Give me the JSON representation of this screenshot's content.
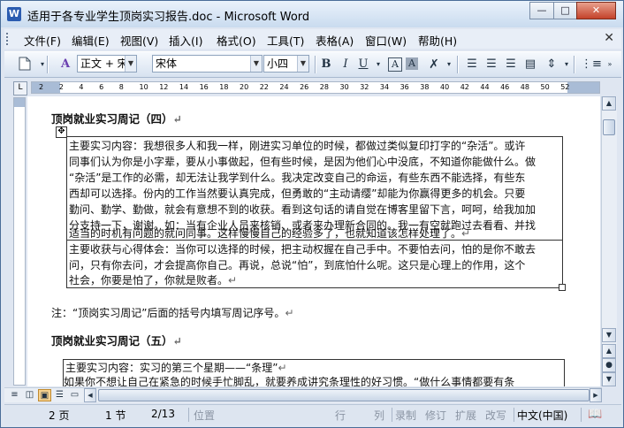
{
  "window": {
    "title": "适用于各专业学生顶岗实习报告.doc - Microsoft Word",
    "app_icon": "W",
    "controls": {
      "minimize": "—",
      "maximize": "□",
      "close": "✕"
    }
  },
  "menu": {
    "items": [
      "文件(F)",
      "编辑(E)",
      "视图(V)",
      "插入(I)",
      "格式(O)",
      "工具(T)",
      "表格(A)",
      "窗口(W)",
      "帮助(H)"
    ],
    "close_doc": "✕"
  },
  "toolbar": {
    "style_value": "正文 + 宋体",
    "font_value": "宋体",
    "size_value": "小四",
    "bold": "B",
    "italic": "I",
    "underline": "U"
  },
  "ruler": {
    "tab_selector": "L",
    "numbers": [
      "2",
      "2",
      "4",
      "6",
      "8",
      "10",
      "12",
      "14",
      "16",
      "18",
      "20",
      "22",
      "24",
      "26",
      "28",
      "30",
      "32",
      "34",
      "36",
      "38",
      "40",
      "42",
      "44",
      "46",
      "48",
      "50",
      "52"
    ]
  },
  "document": {
    "heading4": "顶岗就业实习周记（四）",
    "table1": {
      "row1_lines": [
        "主要实习内容：我想很多人和我一样，刚进实习单位的时候，都做过类似复印打字的“杂活”。或许",
        "同事们认为你是小字辈，要从小事做起，但有些时候，是因为他们心中没底，不知道你能做什么。做",
        "“杂活”是工作的必需，却无法让我学到什么。我决定改变自己的命运，有些东西不能选择，有些东",
        "西却可以选择。份内的工作当然要认真完成，但勇敢的“主动请缨”却能为你赢得更多的机会。只要",
        "勤问、勤学、勤做，就会有意想不到的收获。看到这句话的请自觉在博客里留下言，呵呵，给我加加",
        "分支持一下，谢谢。如：当有企业人员来核销、或者来办理新合同的。我一有空就跑过去看看、并找",
        "适当的时机有问题的就问同事。这样慢慢自己的经验多了，也就知道该怎样处理了。"
      ],
      "row2_lines": [
        "主要收获与心得体会：当你可以选择的时候，把主动权握在自己手中。不要怕去问，怕的是你不敢去",
        "问，只有你去问，才会提高你自己。再说，总说“怕”，到底怕什么呢。这只是心理上的作用，这个",
        "社会，你要是怕了，你就是败者。"
      ]
    },
    "note": "注：“顶岗实习周记”后面的括号内填写周记序号。",
    "heading5": "顶岗就业实习周记（五）",
    "table2_lines": [
      "主要实习内容：实习的第三个星期——“条理”",
      "如果你不想让自己在紧急的时候手忙脚乱，就要养成讲究条理性的好习惯。“做什么事情都要有条"
    ],
    "paragraph_mark": "↵"
  },
  "status": {
    "page": "2 页",
    "section": "1 节",
    "page_of": "2/13",
    "position": "位置",
    "line": "行",
    "col": "列",
    "rec": "录制",
    "trk": "修订",
    "ext": "扩展",
    "ovr": "改写",
    "language": "中文(中国)"
  }
}
